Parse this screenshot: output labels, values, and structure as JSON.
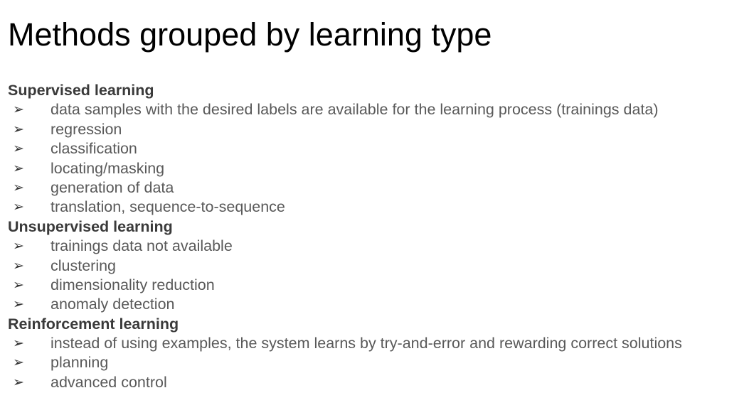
{
  "slide": {
    "title": "Methods grouped by learning type",
    "bullet_glyph": "➢",
    "colors": {
      "title": "#000000",
      "heading": "#3a3a3a",
      "bullet_text": "#595959",
      "background": "#ffffff"
    },
    "sections": [
      {
        "heading": "Supervised learning",
        "items": [
          "data samples with the desired labels are available for the learning process (trainings data)",
          "regression",
          "classification",
          "locating/masking",
          "generation of data",
          "translation, sequence-to-sequence"
        ]
      },
      {
        "heading": "Unsupervised learning",
        "items": [
          "trainings data not available",
          "clustering",
          "dimensionality reduction",
          "anomaly detection"
        ]
      },
      {
        "heading": "Reinforcement learning",
        "items": [
          "instead of using examples, the system learns by try-and-error and rewarding correct solutions",
          "planning",
          "advanced control"
        ]
      }
    ]
  }
}
